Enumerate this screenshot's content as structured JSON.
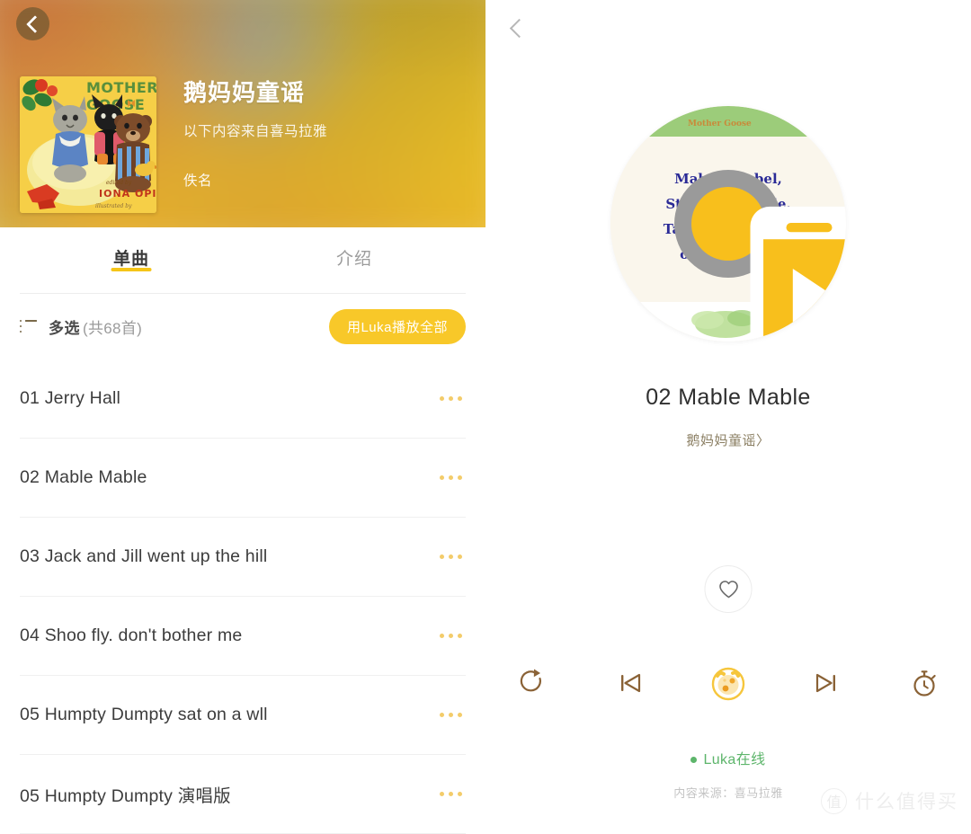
{
  "album_header": {
    "back_icon": "chevron-left-icon",
    "title": "鹅妈妈童谣",
    "subtitle": "以下内容来自喜马拉雅",
    "author": "佚名",
    "cover_alt": "MOTHER GOOSE",
    "cover_texts": {
      "line1": "MOTHER",
      "line2": "GOOSE",
      "credit1": "edited by",
      "credit2": "IONA OPI",
      "credit3": "illustrated by"
    }
  },
  "tabs": [
    {
      "label": "单曲",
      "active": true
    },
    {
      "label": "介绍",
      "active": false
    }
  ],
  "list_toolbar": {
    "list_icon": "list-bullet-icon",
    "multi_select_label": "多选",
    "count_label": "(共68首)",
    "play_all_label": "用Luka播放全部"
  },
  "songs": [
    {
      "title": "01 Jerry Hall",
      "more_icon": "more-horizontal-icon"
    },
    {
      "title": "02 Mable Mable",
      "more_icon": "more-horizontal-icon"
    },
    {
      "title": "03 Jack and Jill went up the hill",
      "more_icon": "more-horizontal-icon"
    },
    {
      "title": "04 Shoo fly. don't bother me",
      "more_icon": "more-horizontal-icon"
    },
    {
      "title": "05 Humpty Dumpty sat on a wll",
      "more_icon": "more-horizontal-icon"
    },
    {
      "title": "05 Humpty Dumpty 演唱版",
      "more_icon": "more-horizontal-icon"
    }
  ],
  "player": {
    "back_icon": "chevron-left-icon",
    "disc": {
      "banner_text": "Mother Goose",
      "page_lines": [
        "Mabel, Mabel,",
        "Strong and able,",
        "Take your elbows",
        "off the table."
      ],
      "play_icon": "phone-play-icon",
      "banner_color": "#9ccc7a",
      "page_color": "#faf6ec",
      "hub_color": "#9a9a9a",
      "knob_color": "#f8bf1c"
    },
    "now_playing_title": "02 Mable Mable",
    "now_playing_album": "鹅妈妈童谣〉",
    "favorite_icon": "heart-outline-icon",
    "controls": [
      {
        "name": "repeat-icon",
        "label": "单曲循环"
      },
      {
        "name": "previous-icon",
        "label": "上一首"
      },
      {
        "name": "luka-play-icon",
        "label": "播放"
      },
      {
        "name": "next-icon",
        "label": "下一首"
      },
      {
        "name": "timer-icon",
        "label": "定时"
      }
    ],
    "status_text": "Luka在线",
    "status_color": "#5db56b",
    "source_note": "内容来源：喜马拉雅"
  },
  "watermark": {
    "mark": "值",
    "text": "什么值得买"
  },
  "theme": {
    "accent_yellow": "#f8c829",
    "knob_yellow": "#f8bf1c",
    "control_brown": "#8a6236",
    "text_dark": "#3c3c3c",
    "text_muted": "#9b9b9b"
  }
}
